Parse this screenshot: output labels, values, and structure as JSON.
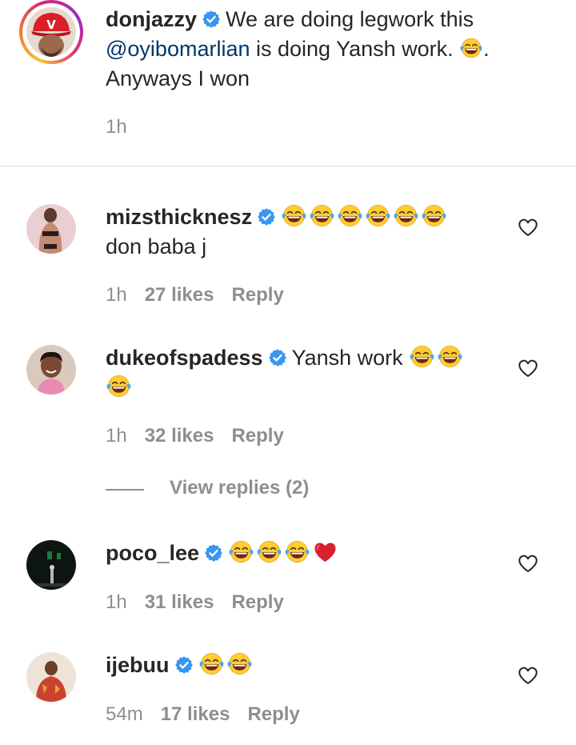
{
  "caption": {
    "username": "donjazzy",
    "text_before_mention": "We are doing legwork this",
    "mention": "@oyibomarlian",
    "text_after_mention": "is doing Yansh work.",
    "text_after_emoji": ".",
    "second_line": "Anyways I won",
    "time": "1h"
  },
  "comments": [
    {
      "username": "mizsthicknesz",
      "text": "don baba j",
      "time": "1h",
      "likes": "27 likes",
      "reply": "Reply"
    },
    {
      "username": "dukeofspadess",
      "text": "Yansh work",
      "time": "1h",
      "likes": "32 likes",
      "reply": "Reply",
      "view_replies": "View replies (2)"
    },
    {
      "username": "poco_lee",
      "text": "",
      "time": "1h",
      "likes": "31 likes",
      "reply": "Reply"
    },
    {
      "username": "ijebuu",
      "text": "",
      "time": "54m",
      "likes": "17 likes",
      "reply": "Reply"
    }
  ],
  "icons": {
    "verified": "verified-badge-icon",
    "emoji": "face-with-tears-of-joy-emoji",
    "heart_emoji": "red-heart-emoji",
    "like": "heart-outline-icon"
  },
  "colors": {
    "verified": "#3897f0",
    "mention": "#00376b",
    "secondary_text": "#8e8e8e",
    "divider": "#dbdbdb"
  }
}
